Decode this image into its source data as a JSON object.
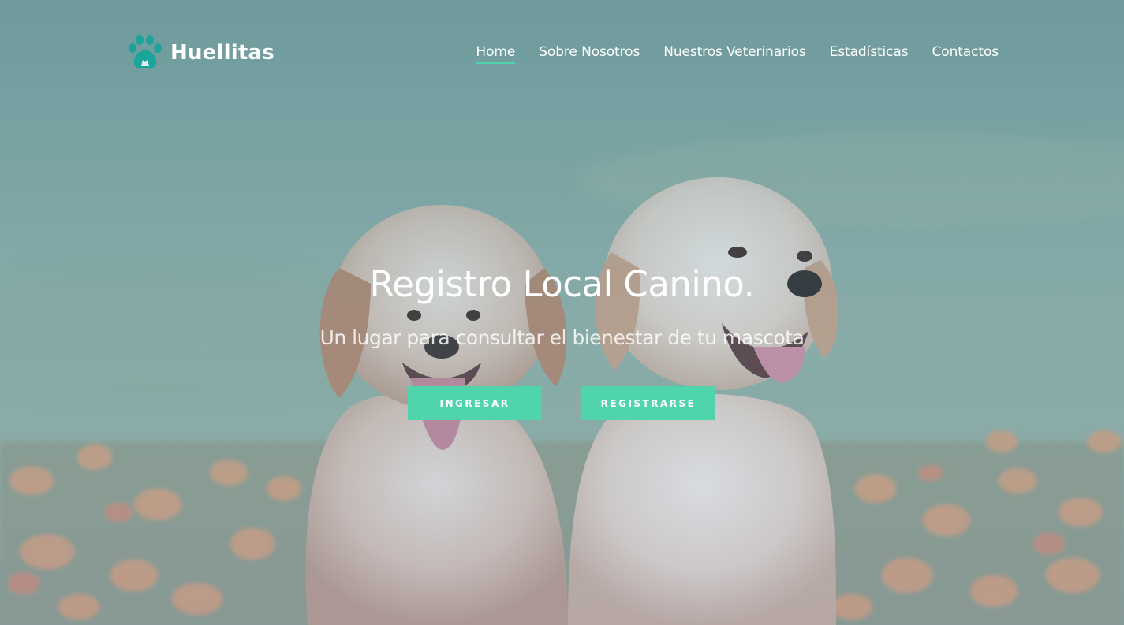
{
  "brand": {
    "name": "Huellitas",
    "logo_icon": "paw-print-icon",
    "logo_color": "#1aa49a"
  },
  "nav": {
    "items": [
      {
        "label": "Home",
        "active": true
      },
      {
        "label": "Sobre Nosotros",
        "active": false
      },
      {
        "label": "Nuestros Veterinarios",
        "active": false
      },
      {
        "label": "Estadísticas",
        "active": false
      },
      {
        "label": "Contactos",
        "active": false
      }
    ]
  },
  "hero": {
    "title": "Registro Local Canino.",
    "subtitle": "Un lugar para consultar el bienestar de tu mascota",
    "background_image": "two-golden-retriever-puppies-in-flower-field",
    "buttons": {
      "login": "INGRESAR",
      "register": "REGISTRARSE"
    }
  },
  "colors": {
    "accent": "#4fd4ab",
    "text": "#ffffff"
  }
}
